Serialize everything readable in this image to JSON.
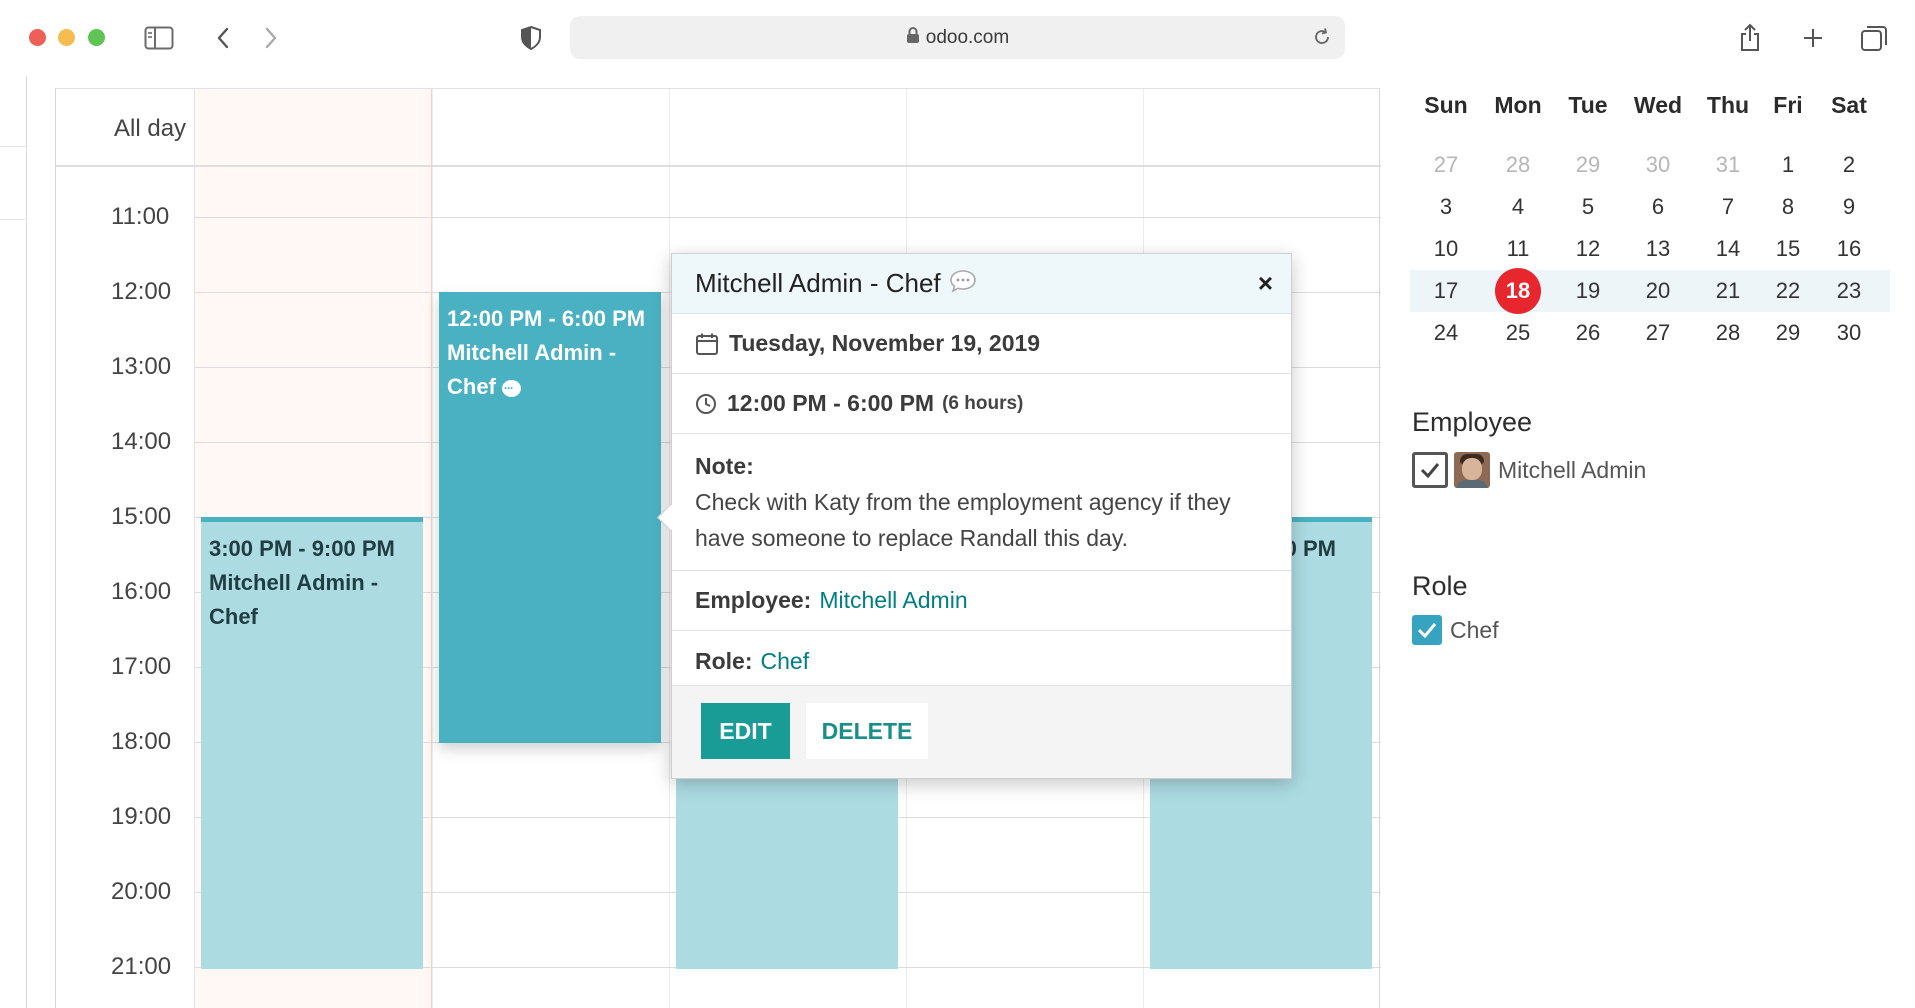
{
  "browser": {
    "url": "odoo.com"
  },
  "calendar": {
    "allday_label": "All day",
    "hours": [
      "11:00",
      "12:00",
      "13:00",
      "14:00",
      "15:00",
      "16:00",
      "17:00",
      "18:00",
      "19:00",
      "20:00",
      "21:00"
    ],
    "events": {
      "monday": {
        "time": "3:00 PM - 9:00 PM",
        "title_line1": "Mitchell Admin -",
        "title_line2": "Chef"
      },
      "tuesday": {
        "time": "12:00 PM - 6:00 PM",
        "title_line1": "Mitchell Admin -",
        "title_line2": "Chef"
      },
      "friday": {
        "time_partial": "0 PM",
        "title_partial": "in -"
      }
    }
  },
  "popover": {
    "title": "Mitchell Admin - Chef",
    "date": "Tuesday, November 19, 2019",
    "time": "12:00 PM - 6:00 PM",
    "duration": "(6 hours)",
    "note_label": "Note:",
    "note_text": "Check with Katy from the employment agency if they have someone to replace Randall this day.",
    "employee_label": "Employee:",
    "employee_value": "Mitchell Admin",
    "role_label": "Role:",
    "role_value": "Chef",
    "edit_label": "EDIT",
    "delete_label": "DELETE",
    "close_symbol": "×"
  },
  "mini_calendar": {
    "weekdays": [
      "Sun",
      "Mon",
      "Tue",
      "Wed",
      "Thu",
      "Fri",
      "Sat"
    ],
    "weeks": [
      [
        "27",
        "28",
        "29",
        "30",
        "31",
        "1",
        "2"
      ],
      [
        "3",
        "4",
        "5",
        "6",
        "7",
        "8",
        "9"
      ],
      [
        "10",
        "11",
        "12",
        "13",
        "14",
        "15",
        "16"
      ],
      [
        "17",
        "18",
        "19",
        "20",
        "21",
        "22",
        "23"
      ],
      [
        "24",
        "25",
        "26",
        "27",
        "28",
        "29",
        "30"
      ]
    ],
    "today": "18"
  },
  "filters": {
    "employee_title": "Employee",
    "employee_item": "Mitchell Admin",
    "role_title": "Role",
    "role_item": "Chef"
  },
  "colors": {
    "event_light": "#acdbe2",
    "event_dark": "#4ab1c3",
    "accent_teal": "#1a9c96",
    "today_red": "#e8262e"
  }
}
